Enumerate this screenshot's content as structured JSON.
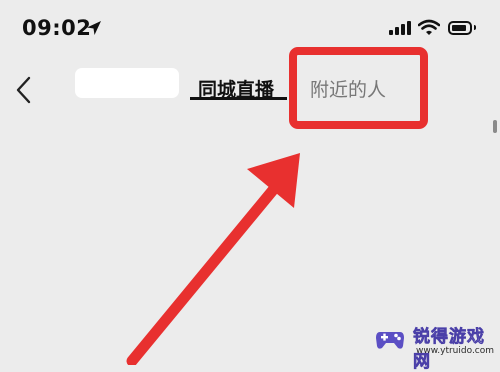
{
  "status_bar": {
    "time": "09:02",
    "icons": [
      "location-arrow-icon",
      "cellular-signal-icon",
      "wifi-icon",
      "battery-icon"
    ]
  },
  "nav": {
    "back_icon": "chevron-left-icon",
    "tabs": [
      {
        "label": "同城直播",
        "active": true
      },
      {
        "label": "附近的人",
        "active": false
      }
    ]
  },
  "annotation": {
    "highlight_color": "#e8302f"
  },
  "watermark": {
    "brand": "锐得游戏网",
    "url": "www.ytruido.com"
  }
}
